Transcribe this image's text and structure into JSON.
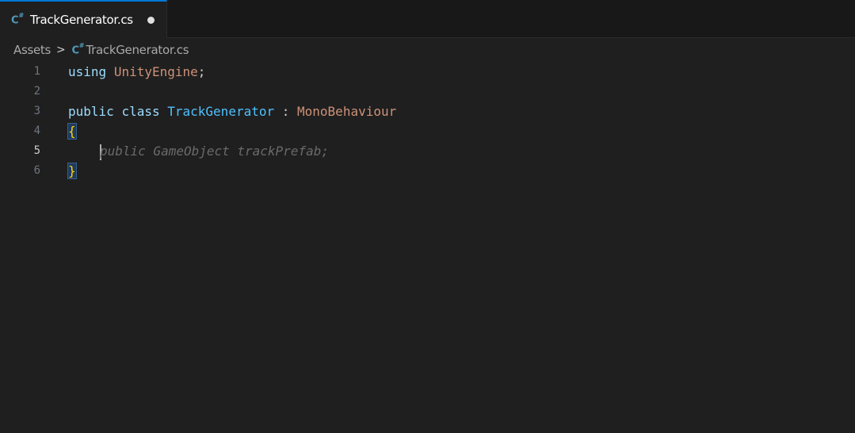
{
  "tab": {
    "icon": "csharp-icon",
    "title": "TrackGenerator.cs",
    "modified": true
  },
  "breadcrumb": {
    "folder": "Assets",
    "separator": ">",
    "file_icon": "csharp-icon",
    "file": "TrackGenerator.cs"
  },
  "editor": {
    "active_line": 5,
    "lines": [
      {
        "number": "1",
        "tokens": {
          "using": "using",
          "ns": "UnityEngine",
          "end": ";"
        }
      },
      {
        "number": "2"
      },
      {
        "number": "3",
        "tokens": {
          "public": "public",
          "class": "class",
          "name": "TrackGenerator",
          "colon": " : ",
          "base": "MonoBehaviour"
        }
      },
      {
        "number": "4",
        "tokens": {
          "open": "{"
        }
      },
      {
        "number": "5",
        "tokens": {
          "ghost": "public GameObject trackPrefab;"
        }
      },
      {
        "number": "6",
        "tokens": {
          "close": "}"
        }
      }
    ]
  },
  "colors": {
    "tab_accent": "#0078d4",
    "csharp_icon": "#519aba",
    "background": "#1f1f1f",
    "bracket": "#ffd700"
  }
}
